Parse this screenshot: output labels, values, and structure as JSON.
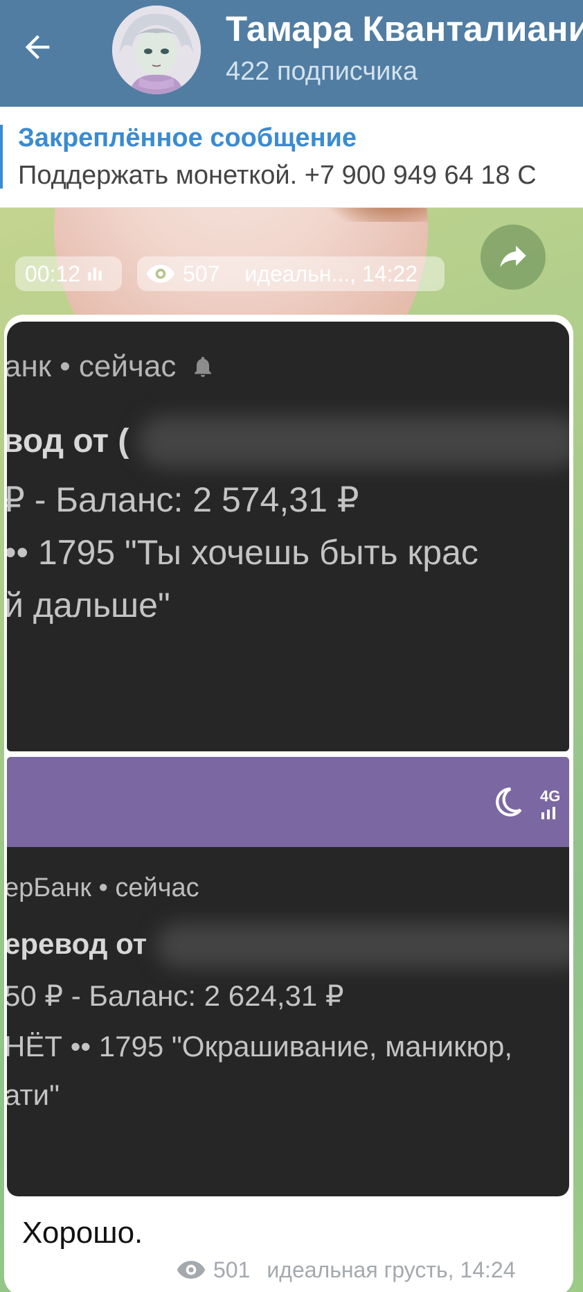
{
  "header": {
    "title": "Тамара Кванталиани",
    "subtitle": "422 подписчика",
    "back_icon": "arrow-left-icon"
  },
  "pinned": {
    "title": "Закреплённое сообщение",
    "text": "Поддержать монеткой. +7 900 949 64 18 С"
  },
  "round_video": {
    "duration": "00:12",
    "views": "507",
    "signature": "идеальн..., 14:22"
  },
  "photo1": {
    "line1": "анк • сейчас",
    "line2": "вод от (",
    "line3": "₽ - Баланс: 2 574,31 ₽",
    "line4": "•• 1795 \"Ты хочешь быть крас",
    "line5": "й дальше\""
  },
  "photo2": {
    "status": "4G",
    "line1": "ерБанк • сейчас",
    "line2": "еревод от",
    "line3": "50 ₽ - Баланс: 2 624,31 ₽",
    "line4": "НЁТ •• 1795 \"Окрашивание, маникюр,",
    "line5": "ати\""
  },
  "message": {
    "text": "Хорошо.",
    "views": "501",
    "signature": "идеальная грусть, 14:24"
  },
  "colors": {
    "header": "#517da2",
    "accent": "#3a8bd1",
    "purple": "#7b67a1"
  }
}
